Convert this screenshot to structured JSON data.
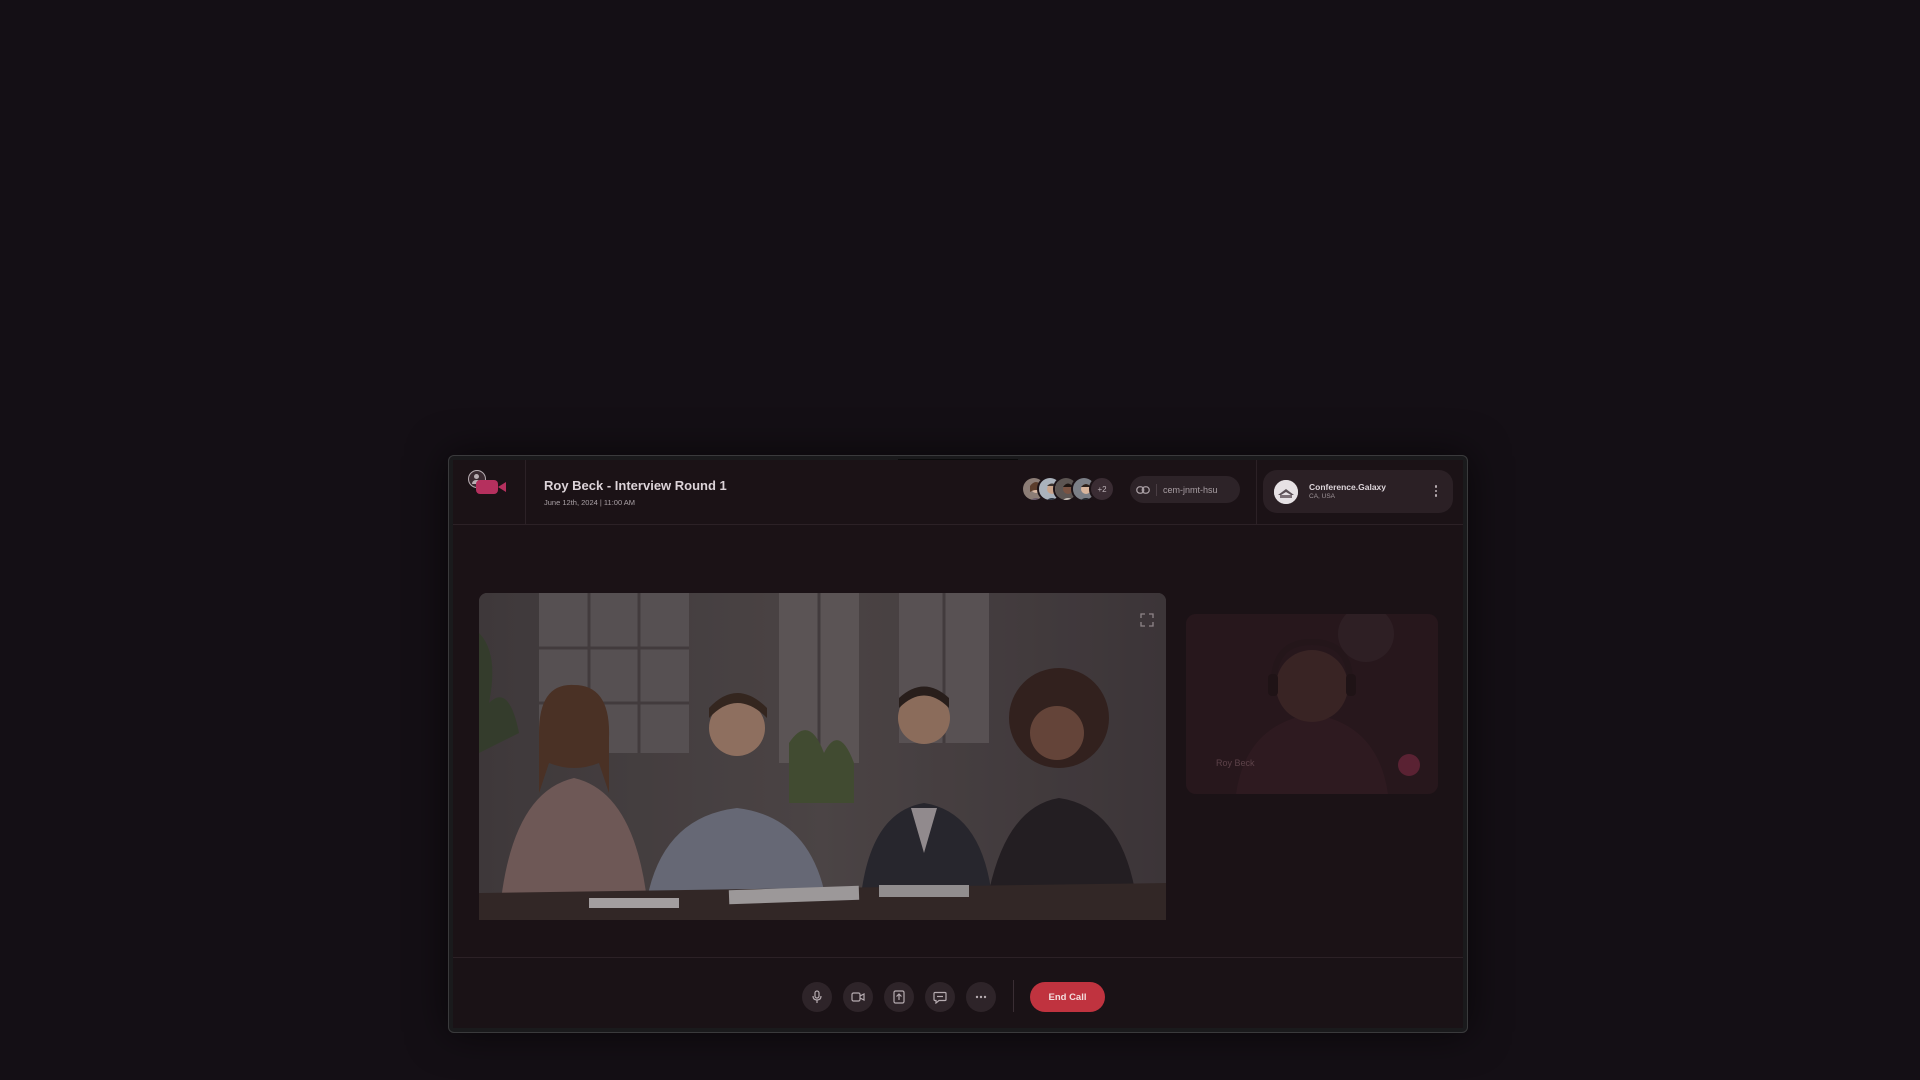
{
  "meeting": {
    "title": "Roy Beck - Interview Round 1",
    "datetime": "June 12th, 2024 | 11:00 AM"
  },
  "participants": {
    "more_count": "+2"
  },
  "invite": {
    "code": "cem-jnmt-hsu"
  },
  "organization": {
    "name": "Conference.Galaxy",
    "location": "CA, USA"
  },
  "side_tile": {
    "participant_name": "Roy Beck"
  },
  "controls": {
    "end_call_label": "End Call"
  },
  "icons": [
    "person-icon",
    "camera-icon",
    "link-icon",
    "more-vertical-icon",
    "expand-icon",
    "mic-icon",
    "video-icon",
    "share-screen-icon",
    "chat-icon",
    "more-horizontal-icon"
  ],
  "colors": {
    "accent": "#c0333f",
    "brand": "#b5305e",
    "background": "#140f15"
  }
}
